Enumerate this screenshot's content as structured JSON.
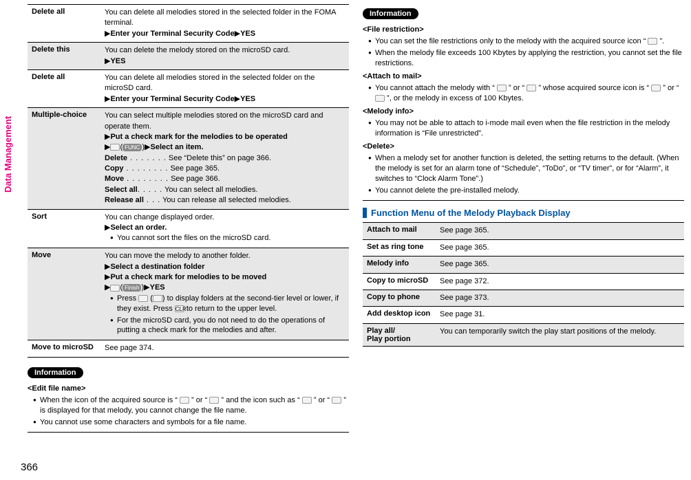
{
  "side_tab": "Data Management",
  "page_number": "366",
  "left_table": [
    {
      "shaded": false,
      "label": "Delete all",
      "body_html": "You can delete all melodies stored in the selected folder in the FOMA terminal.<br>▶<b>Enter your Terminal Security Code</b>▶<b>YES</b>"
    },
    {
      "shaded": true,
      "label": "Delete this",
      "body_html": "You can delete the melody stored on the microSD card.<br>▶<b>YES</b>"
    },
    {
      "shaded": false,
      "label": "Delete all",
      "body_html": "You can delete all melodies stored in the selected folder on the microSD card.<br>▶<b>Enter your Terminal Security Code</b>▶<b>YES</b>"
    },
    {
      "shaded": true,
      "label": "Multiple-choice",
      "body_html": "You can select multiple melodies stored on the microSD card and operate them.<br>▶<b>Put a check mark for the melodies to be operated</b><br>▶<span class='icon-placeholder'></span>(<span class='pill'>FUNC</span>)▶<b>Select an item.</b><br><b>Delete</b><span class='dots'> . . . . . . .</span> See “Delete this” on page 366.<br><b>Copy</b><span class='dots'> . . . . . . . .</span> See page 365.<br><b>Move</b><span class='dots'> . . . . . . . .</span> See page 366.<br><b>Select all</b><span class='dots'>. . . . .</span> You can select all melodies.<br><b>Release all</b><span class='dots'> . . .</span> You can release all selected melodies."
    },
    {
      "shaded": false,
      "label": "Sort",
      "body_html": "You can change displayed order.<br>▶<b>Select an order.</b><br><ul class='bullet-list'><li>You cannot sort the files on the microSD card.</li></ul>"
    },
    {
      "shaded": true,
      "label": "Move",
      "body_html": "You can move the melody to another folder.<br>▶<b>Select a destination folder</b><br>▶<b>Put a check mark for melodies to be moved</b><br>▶<span class='icon-placeholder'></span>(<span class='pill'>Finish</span>)▶<b>YES</b><br><ul class='bullet-list'><li>Press <span class='icon-placeholder'></span> (<span class='icon-placeholder'></span>) to display folders at the second-tier level or lower, if they exist. Press <span class='icon-placeholder'>CLR</span> to return to the upper level.</li><li>For the microSD card, you do not need to do the operations of putting a check mark for the melodies and after.</li></ul>"
    },
    {
      "shaded": false,
      "label": "Move to microSD",
      "body_html": "See page 374."
    }
  ],
  "info_label": "Information",
  "left_info": {
    "sections": [
      {
        "heading": "<Edit file name>",
        "bullets": [
          "When the icon of the acquired source is “ <span class='icon-placeholder'></span> ” or “ <span class='icon-placeholder'></span> ” and the icon such as “ <span class='icon-placeholder'></span> ” or “ <span class='icon-placeholder'></span> ” is displayed for that melody, you cannot change the file name.",
          "You cannot use some characters and symbols for a file name."
        ]
      }
    ]
  },
  "right_info": {
    "sections": [
      {
        "heading": "<File restriction>",
        "bullets": [
          "You can set the file restrictions only to the melody with the acquired source icon “ <span class='icon-placeholder'></span> ”.",
          "When the melody file exceeds 100 Kbytes by applying the restriction, you cannot set the file restrictions."
        ]
      },
      {
        "heading": "<Attach to mail>",
        "bullets": [
          "You cannot attach the melody with “ <span class='icon-placeholder'></span> ” or “ <span class='icon-placeholder'></span> ” whose acquired source icon is “ <span class='icon-placeholder'></span> ” or “ <span class='icon-placeholder'></span> ”, or the melody in excess of 100 Kbytes."
        ]
      },
      {
        "heading": "<Melody info>",
        "bullets": [
          "You may not be able to attach to i-mode mail even when the file restriction in the melody information is “File unrestricted”."
        ]
      },
      {
        "heading": "<Delete>",
        "bullets": [
          "When a melody set for another function is deleted, the setting returns to the default. (When the melody is set for an alarm tone of “Schedule”, “ToDo”, or “TV timer”, or for “Alarm”, it switches to “Clock Alarm Tone”.)",
          "You cannot delete the pre-installed melody."
        ]
      }
    ]
  },
  "blue_heading": "Function Menu of the Melody Playback Display",
  "right_table": [
    {
      "shaded": true,
      "label": "Attach to mail",
      "body": "See page 365."
    },
    {
      "shaded": false,
      "label": "Set as ring tone",
      "body": "See page 365."
    },
    {
      "shaded": true,
      "label": "Melody info",
      "body": "See page 365."
    },
    {
      "shaded": false,
      "label": "Copy to microSD",
      "body": "See page 372."
    },
    {
      "shaded": true,
      "label": "Copy to phone",
      "body": "See page 373."
    },
    {
      "shaded": false,
      "label": "Add desktop icon",
      "body": "See page 31."
    },
    {
      "shaded": true,
      "label": "Play all/\nPlay portion",
      "body": "You can temporarily switch the play start positions of the melody."
    }
  ]
}
